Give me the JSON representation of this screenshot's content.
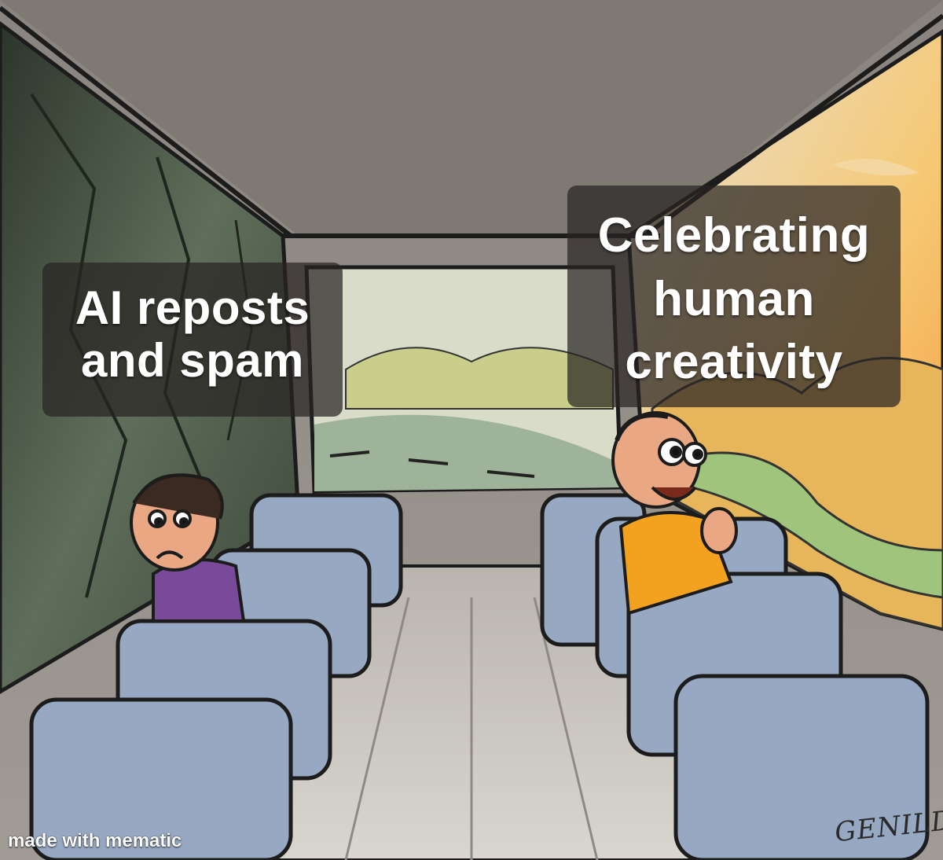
{
  "captions": {
    "left": [
      "AI reposts",
      "and spam"
    ],
    "right": [
      "Celebrating",
      "human",
      "creativity"
    ]
  },
  "watermark": "made with mematic",
  "signature": "GENILDO",
  "colors": {
    "wall_dark": "#2f3a2e",
    "wall_mid": "#5d6b58",
    "ceiling": "#8a8480",
    "sky_warm": "#f4b24a",
    "hills_green": "#a9c27a",
    "seat_blue": "#97a8c2",
    "seat_shadow": "#6e7f9a",
    "floor": "#c8c4bf",
    "sad_shirt": "#7a4a9a",
    "happy_shirt": "#f3a21f"
  }
}
